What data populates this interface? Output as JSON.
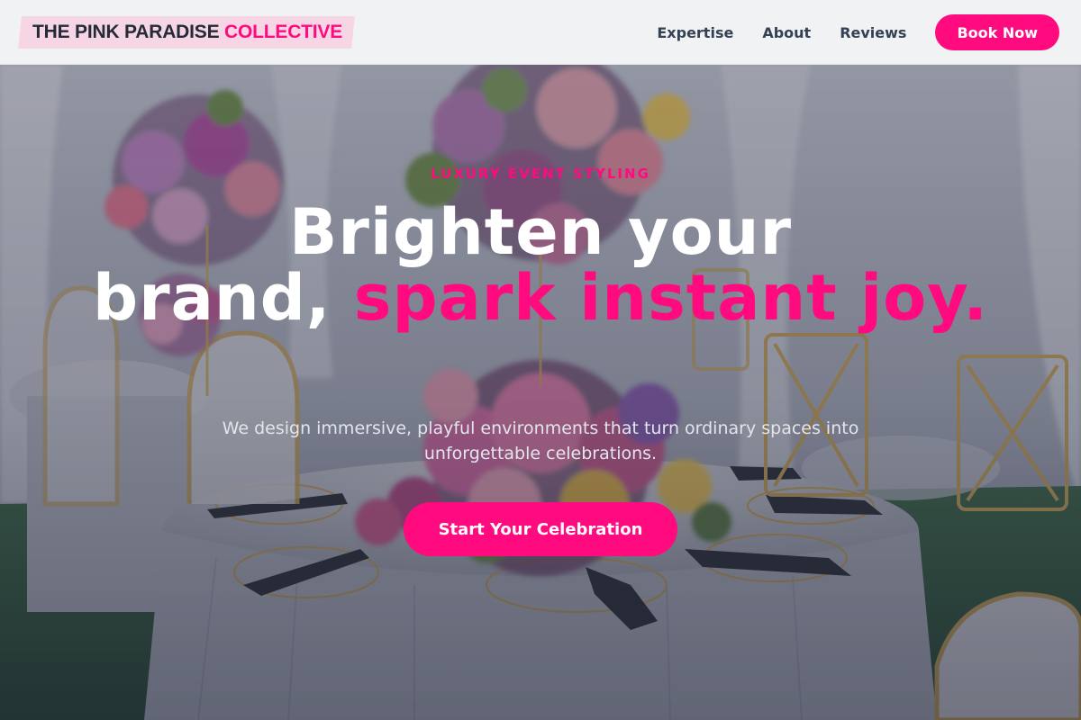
{
  "brand": {
    "name_primary": "THE PINK PARADISE",
    "name_accent": "COLLECTIVE"
  },
  "nav": {
    "links": [
      "Expertise",
      "About",
      "Reviews"
    ],
    "cta_label": "Book Now"
  },
  "hero": {
    "eyebrow": "LUXURY EVENT STYLING",
    "headline_line1": "Brighten your",
    "headline_line2_start": "brand, ",
    "headline_accent": "spark instant joy.",
    "subhead": "We design immersive, playful environments that turn ordinary spaces into unforgettable celebrations.",
    "cta_label": "Start Your Celebration"
  },
  "colors": {
    "accent": "#ff0a7f",
    "header_bg": "#f1f2f4",
    "logo_highlight": "#f6d6e5",
    "text_dark": "#252a38",
    "nav_text": "#344155"
  }
}
